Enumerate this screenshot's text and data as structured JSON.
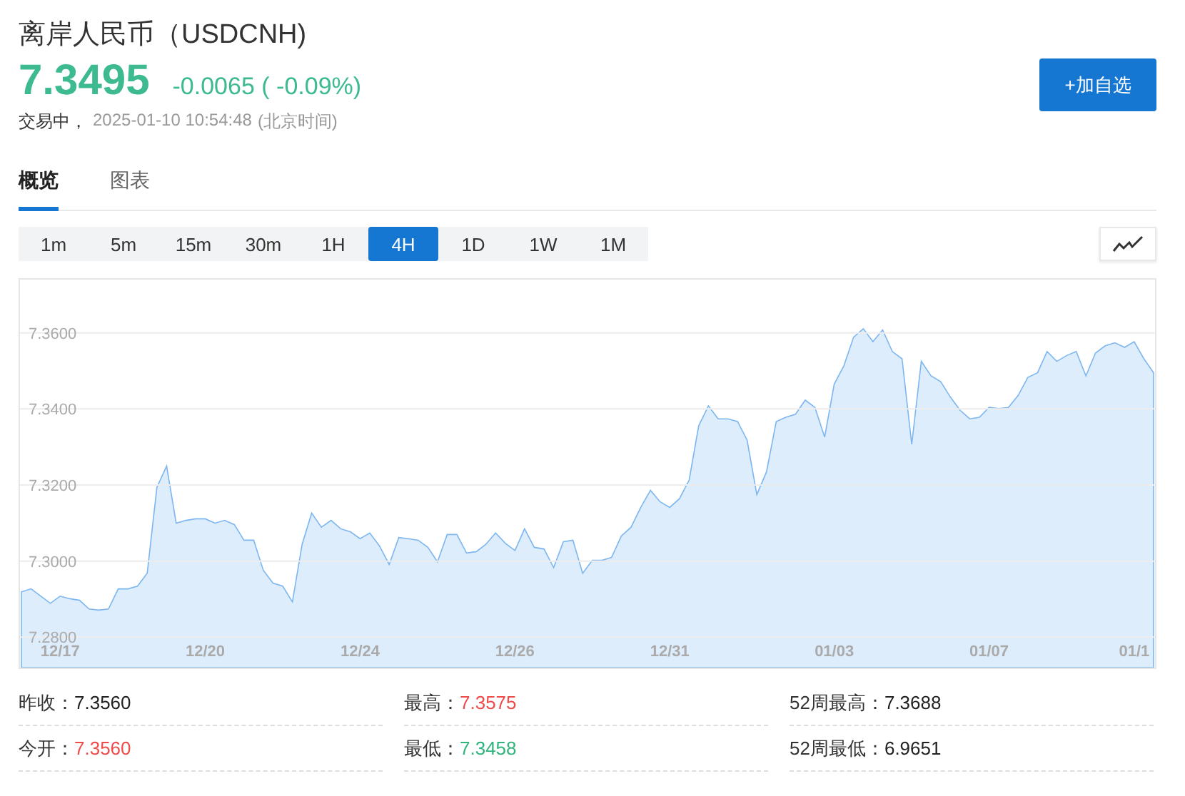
{
  "header": {
    "title": "离岸人民币（USDCNH)",
    "price": "7.3495",
    "change": "-0.0065 ( -0.09%)",
    "status": "交易中，",
    "time": "2025-01-10 10:54:48",
    "timezone": "(北京时间)",
    "add_button": "+加自选"
  },
  "tabs": [
    {
      "label": "概览",
      "selected": true
    },
    {
      "label": "图表",
      "selected": false
    }
  ],
  "intervals": [
    {
      "label": "1m",
      "selected": false
    },
    {
      "label": "5m",
      "selected": false
    },
    {
      "label": "15m",
      "selected": false
    },
    {
      "label": "30m",
      "selected": false
    },
    {
      "label": "1H",
      "selected": false
    },
    {
      "label": "4H",
      "selected": true
    },
    {
      "label": "1D",
      "selected": false
    },
    {
      "label": "1W",
      "selected": false
    },
    {
      "label": "1M",
      "selected": false
    }
  ],
  "chart_data": {
    "type": "area",
    "grid": true,
    "ylim": [
      7.272,
      7.374
    ],
    "categories": [
      null,
      null,
      null,
      null,
      "12/17",
      null,
      null,
      null,
      null,
      null,
      null,
      null,
      null,
      null,
      null,
      null,
      null,
      null,
      null,
      "12/20",
      null,
      null,
      null,
      null,
      null,
      null,
      null,
      null,
      null,
      null,
      null,
      null,
      null,
      null,
      null,
      "12/24",
      null,
      null,
      null,
      null,
      null,
      null,
      null,
      null,
      null,
      null,
      null,
      null,
      null,
      null,
      null,
      "12/26",
      null,
      null,
      null,
      null,
      null,
      null,
      null,
      null,
      null,
      null,
      null,
      null,
      null,
      null,
      null,
      "12/31",
      null,
      null,
      null,
      null,
      null,
      null,
      null,
      null,
      null,
      null,
      null,
      null,
      null,
      null,
      null,
      null,
      "01/03",
      null,
      null,
      null,
      null,
      null,
      null,
      null,
      null,
      null,
      null,
      null,
      null,
      null,
      null,
      null,
      "01/07",
      null,
      null,
      null,
      null,
      null,
      null,
      null,
      null,
      null,
      null,
      null,
      null,
      null,
      null,
      "01/1",
      null,
      null
    ],
    "yticks": [
      {
        "value": 7.28,
        "label": "7.2800"
      },
      {
        "value": 7.3,
        "label": "7.3000"
      },
      {
        "value": 7.32,
        "label": "7.3200"
      },
      {
        "value": 7.34,
        "label": "7.3400"
      },
      {
        "value": 7.36,
        "label": "7.3600"
      }
    ],
    "series": [
      {
        "color": "#7cb6f0",
        "values": [
          7.2919,
          7.2927,
          7.2908,
          7.2889,
          7.2908,
          7.2901,
          7.2897,
          7.2874,
          7.2871,
          7.2874,
          7.2927,
          7.2927,
          7.2934,
          7.2968,
          7.3194,
          7.325,
          7.31,
          7.3107,
          7.3111,
          7.3111,
          7.31,
          7.3107,
          7.3096,
          7.3055,
          7.3055,
          7.2976,
          7.2942,
          7.2934,
          7.2893,
          7.3044,
          7.3126,
          7.3089,
          7.3107,
          7.3085,
          7.3077,
          7.3059,
          7.3074,
          7.304,
          7.2991,
          7.3062,
          7.3059,
          7.3055,
          7.3036,
          7.2998,
          7.307,
          7.307,
          7.3021,
          7.3025,
          7.3044,
          7.3074,
          7.3047,
          7.3028,
          7.3085,
          7.3036,
          7.3032,
          7.2983,
          7.3051,
          7.3055,
          7.2968,
          7.3002,
          7.3002,
          7.301,
          7.3066,
          7.3089,
          7.3141,
          7.3186,
          7.3156,
          7.3141,
          7.3164,
          7.3213,
          7.3356,
          7.3408,
          7.3374,
          7.3374,
          7.3367,
          7.3318,
          7.3175,
          7.3235,
          7.3367,
          7.3378,
          7.3386,
          7.3423,
          7.3404,
          7.3326,
          7.3465,
          7.3514,
          7.3589,
          7.3611,
          7.3577,
          7.3608,
          7.3551,
          7.3532,
          7.3307,
          7.3525,
          7.3487,
          7.3472,
          7.3431,
          7.3397,
          7.3374,
          7.3378,
          7.3404,
          7.3401,
          7.3404,
          7.3435,
          7.3483,
          7.3495,
          7.3551,
          7.3525,
          7.354,
          7.3551,
          7.3487,
          7.3547,
          7.3566,
          7.3574,
          7.3562,
          7.3577,
          7.3532,
          7.3495
        ]
      }
    ]
  },
  "stats": [
    {
      "label": "昨收：",
      "value": "7.3560",
      "color": "#222222"
    },
    {
      "label": "最高：",
      "value": "7.3575",
      "color": "#f04b4b"
    },
    {
      "label": "52周最高：",
      "value": "7.3688",
      "color": "#222222"
    },
    {
      "label": "今开：",
      "value": "7.3560",
      "color": "#f04b4b"
    },
    {
      "label": "最低：",
      "value": "7.3458",
      "color": "#2fb47c"
    },
    {
      "label": "52周最低：",
      "value": "6.9651",
      "color": "#222222"
    }
  ]
}
